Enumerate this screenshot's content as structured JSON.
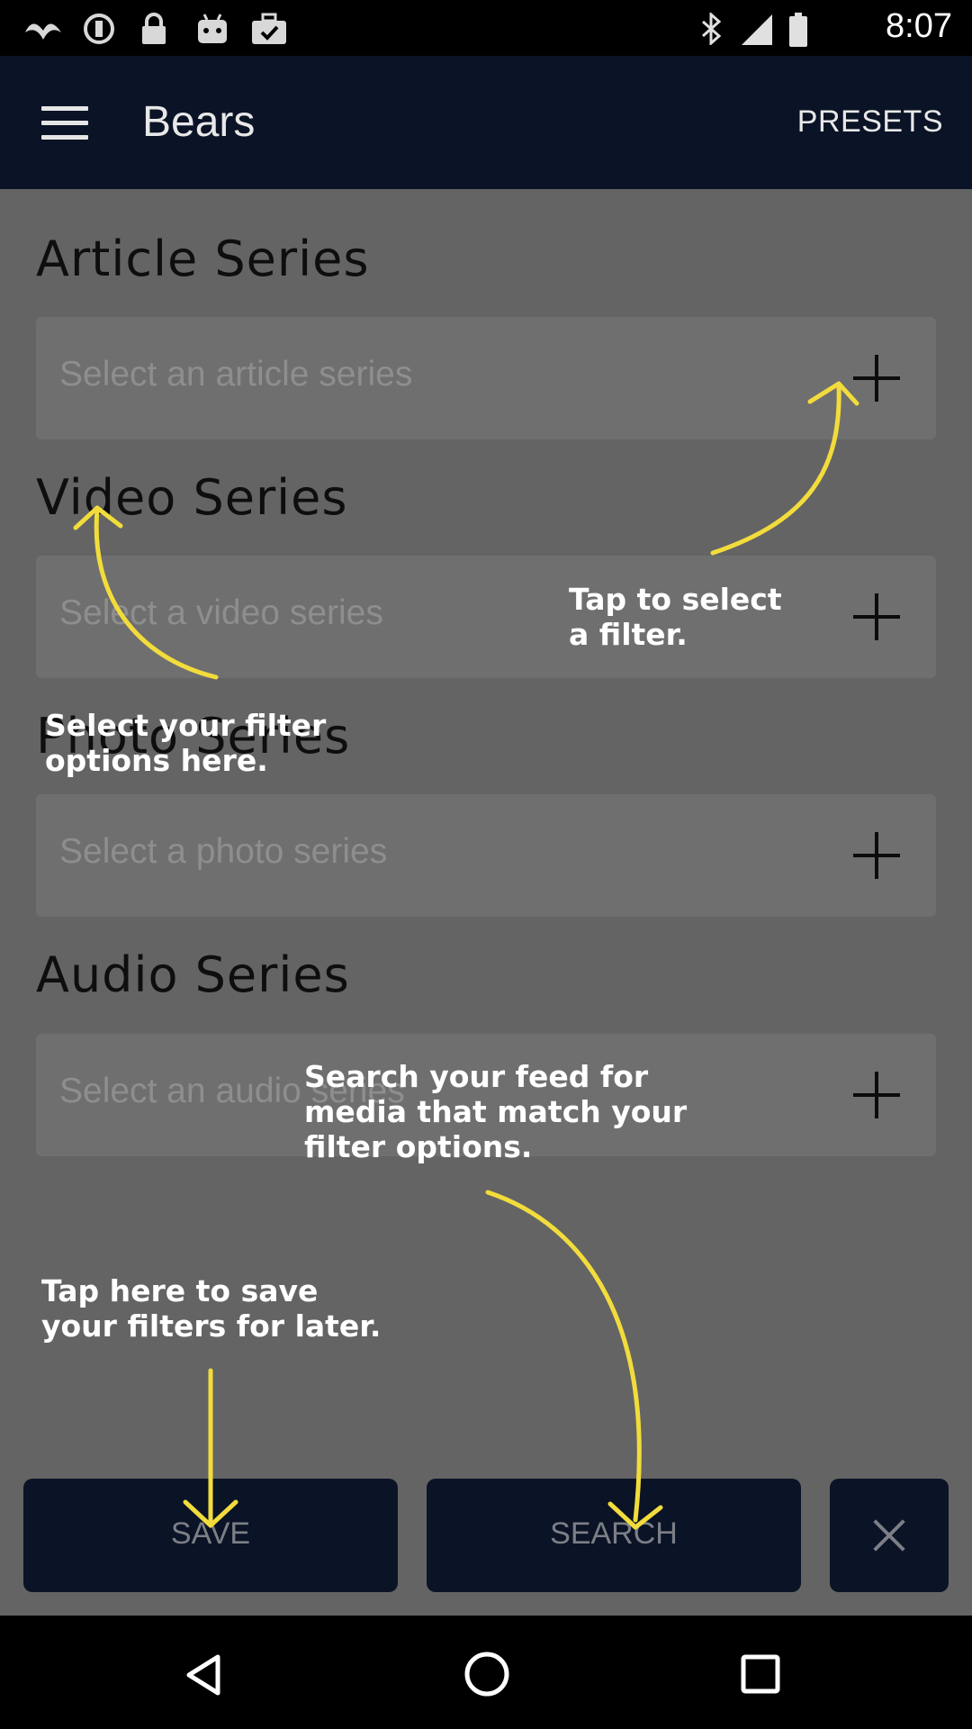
{
  "status_bar": {
    "time": "8:07",
    "left_icons": [
      "bird-icon",
      "circle-notification-icon",
      "lock-icon",
      "robot-icon",
      "briefcase-check-icon"
    ],
    "right_icons": [
      "bluetooth-icon",
      "signal-icon",
      "battery-icon"
    ]
  },
  "app_bar": {
    "title": "Bears",
    "menu_icon": "hamburger-menu-icon",
    "presets_label": "PRESETS",
    "background": "#0b1326"
  },
  "sections": [
    {
      "title": "Article Series",
      "placeholder": "Select an article series"
    },
    {
      "title": "Video Series",
      "placeholder": "Select a video series"
    },
    {
      "title": "Photo Series",
      "placeholder": "Select a photo series"
    },
    {
      "title": "Audio Series",
      "placeholder": "Select an audio series"
    }
  ],
  "buttons": {
    "save_label": "SAVE",
    "search_label": "SEARCH",
    "close_icon": "close-icon"
  },
  "hints": {
    "tap_filter_line1": "Tap to select",
    "tap_filter_line2": "a filter.",
    "filter_options_line1": "Select your filter",
    "filter_options_line2": "options here.",
    "search_feed_line1": "Search your feed for",
    "search_feed_line2": "media that match your",
    "search_feed_line3": "filter options.",
    "save_line1": "Tap here to save",
    "save_line2": "your filters for later."
  },
  "colors": {
    "overlay_arrow": "#f2dc3c",
    "content_background": "#646464",
    "input_background": "#6f6f6f"
  },
  "nav_bar": {
    "icons": [
      "back-icon",
      "home-icon",
      "recents-icon"
    ]
  }
}
